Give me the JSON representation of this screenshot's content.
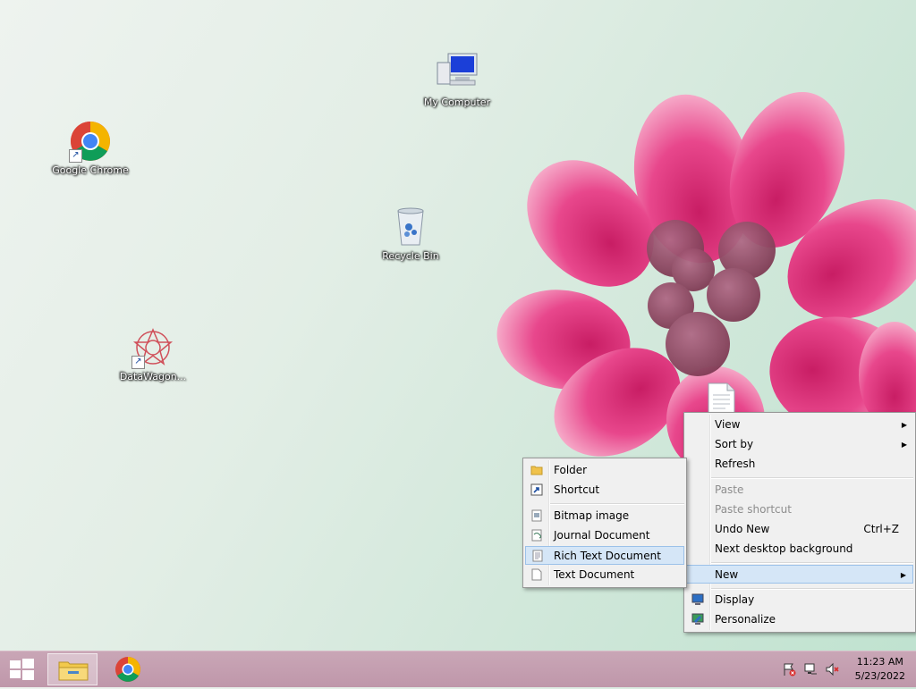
{
  "desktop_icons": {
    "chrome": "Google Chrome",
    "my_computer": "My Computer",
    "recycle_bin": "Recycle Bin",
    "datawagon": "DataWagon..."
  },
  "context_menu": {
    "view": "View",
    "sort_by": "Sort by",
    "refresh": "Refresh",
    "paste": "Paste",
    "paste_shortcut": "Paste shortcut",
    "undo_new": "Undo New",
    "undo_new_shortcut": "Ctrl+Z",
    "next_background": "Next desktop background",
    "new": "New",
    "display": "Display",
    "personalize": "Personalize"
  },
  "new_submenu": {
    "folder": "Folder",
    "shortcut": "Shortcut",
    "bitmap": "Bitmap image",
    "journal": "Journal Document",
    "rich_text": "Rich Text Document",
    "text": "Text Document"
  },
  "taskbar": {
    "time": "11:23 AM",
    "date": "5/23/2022"
  },
  "icons": {
    "start": "windows-start-icon",
    "explorer": "file-explorer-icon",
    "chrome": "chrome-icon",
    "tray_flag": "action-center-flag-icon",
    "tray_network": "network-icon",
    "tray_volume": "volume-muted-icon"
  },
  "colors": {
    "menu_highlight": "#d5e6f7",
    "taskbar": "#c4a0b0",
    "flower": "#e4357f"
  }
}
